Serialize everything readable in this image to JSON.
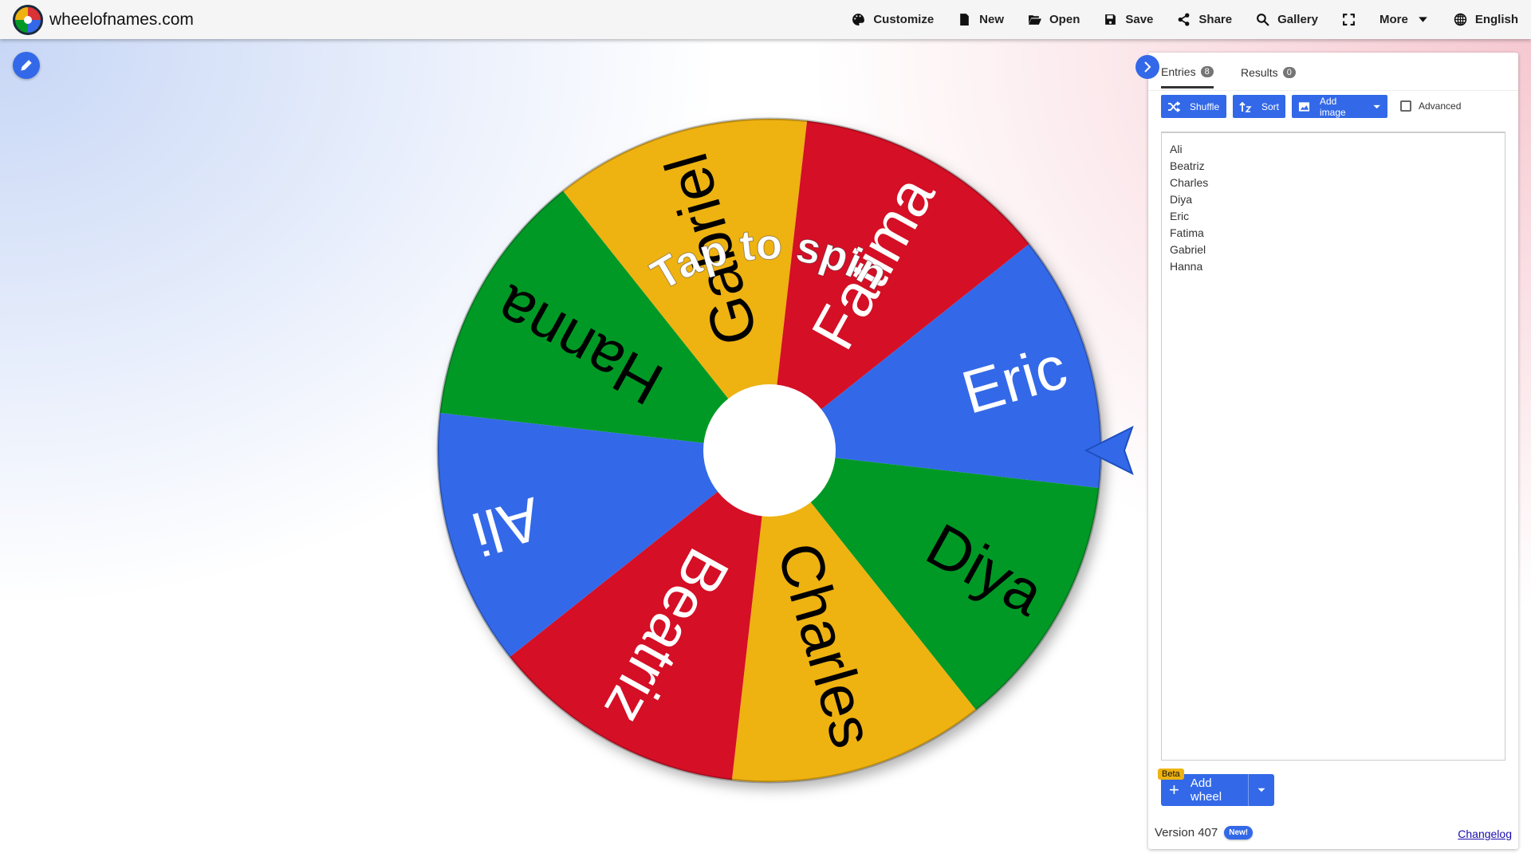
{
  "header": {
    "site_title": "wheelofnames.com",
    "menu": [
      {
        "label": "Customize",
        "icon": "palette-icon"
      },
      {
        "label": "New",
        "icon": "file-icon"
      },
      {
        "label": "Open",
        "icon": "folder-open-icon"
      },
      {
        "label": "Save",
        "icon": "save-icon"
      },
      {
        "label": "Share",
        "icon": "share-icon"
      },
      {
        "label": "Gallery",
        "icon": "search-icon"
      },
      {
        "label": "",
        "icon": "fullscreen-icon"
      },
      {
        "label": "More",
        "icon": "caret-down-icon"
      },
      {
        "label": "English",
        "icon": "globe-icon"
      }
    ]
  },
  "wheel": {
    "prompt": "Tap to spin",
    "slices": [
      {
        "name": "Eric",
        "color": "#3369e8",
        "text": "#ffffff"
      },
      {
        "name": "Diya",
        "color": "#009925",
        "text": "#000000"
      },
      {
        "name": "Charles",
        "color": "#eeb211",
        "text": "#000000"
      },
      {
        "name": "Beatriz",
        "color": "#d50f25",
        "text": "#ffffff"
      },
      {
        "name": "Ali",
        "color": "#3369e8",
        "text": "#ffffff"
      },
      {
        "name": "Hanna",
        "color": "#009925",
        "text": "#000000"
      },
      {
        "name": "Gabriel",
        "color": "#eeb211",
        "text": "#000000"
      },
      {
        "name": "Fatima",
        "color": "#d50f25",
        "text": "#ffffff"
      }
    ]
  },
  "panel": {
    "tabs": [
      {
        "label": "Entries",
        "count": "8"
      },
      {
        "label": "Results",
        "count": "0"
      }
    ],
    "buttons": {
      "shuffle": "Shuffle",
      "sort": "Sort",
      "add_image": "Add image",
      "advanced": "Advanced"
    },
    "entries_text": "Ali\nBeatriz\nCharles\nDiya\nEric\nFatima\nGabriel\nHanna",
    "add_wheel": "Add wheel",
    "beta": "Beta",
    "version": "Version 407",
    "new_badge": "New!",
    "changelog": "Changelog"
  }
}
